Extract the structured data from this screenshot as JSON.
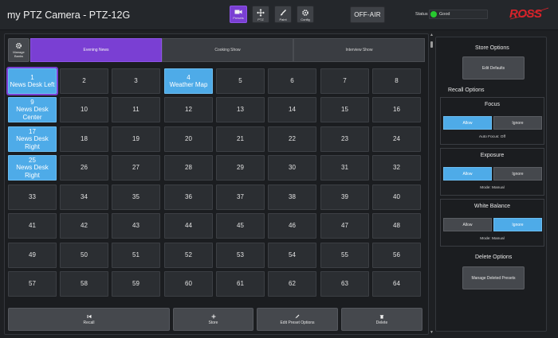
{
  "header": {
    "title": "my PTZ Camera - PTZ-12G",
    "nav": [
      {
        "label": "Presets",
        "icon": "camera-icon",
        "active": true
      },
      {
        "label": "PTZ",
        "icon": "move-arrows-icon",
        "active": false
      },
      {
        "label": "Paint",
        "icon": "paint-brush-icon",
        "active": false
      },
      {
        "label": "Config",
        "icon": "gear-icon",
        "active": false
      }
    ],
    "offair_label": "OFF-AIR",
    "status_label": "Status",
    "status_value": "Good",
    "status_color": "#27c92f",
    "brand": "ROSS"
  },
  "banks": {
    "manage_label": "Manage Banks",
    "tabs": [
      "Evening News",
      "Cooking Show",
      "Interview Show"
    ],
    "active_tab": "Evening News"
  },
  "presets": [
    {
      "n": "1",
      "name": "News Desk Left",
      "stored": true,
      "selected": true
    },
    {
      "n": "2"
    },
    {
      "n": "3"
    },
    {
      "n": "4",
      "name": "Weather Map",
      "stored": true
    },
    {
      "n": "5"
    },
    {
      "n": "6"
    },
    {
      "n": "7"
    },
    {
      "n": "8"
    },
    {
      "n": "9",
      "name": "News Desk Center",
      "stored": true
    },
    {
      "n": "10"
    },
    {
      "n": "11"
    },
    {
      "n": "12"
    },
    {
      "n": "13"
    },
    {
      "n": "14"
    },
    {
      "n": "15"
    },
    {
      "n": "16"
    },
    {
      "n": "17",
      "name": "News Desk Right",
      "stored": true
    },
    {
      "n": "18"
    },
    {
      "n": "19"
    },
    {
      "n": "20"
    },
    {
      "n": "21"
    },
    {
      "n": "22"
    },
    {
      "n": "23"
    },
    {
      "n": "24"
    },
    {
      "n": "25",
      "name": "News Desk Right",
      "stored": true
    },
    {
      "n": "26"
    },
    {
      "n": "27"
    },
    {
      "n": "28"
    },
    {
      "n": "29"
    },
    {
      "n": "30"
    },
    {
      "n": "31"
    },
    {
      "n": "32"
    },
    {
      "n": "33"
    },
    {
      "n": "34"
    },
    {
      "n": "35"
    },
    {
      "n": "36"
    },
    {
      "n": "37"
    },
    {
      "n": "38"
    },
    {
      "n": "39"
    },
    {
      "n": "40"
    },
    {
      "n": "41"
    },
    {
      "n": "42"
    },
    {
      "n": "43"
    },
    {
      "n": "44"
    },
    {
      "n": "45"
    },
    {
      "n": "46"
    },
    {
      "n": "47"
    },
    {
      "n": "48"
    },
    {
      "n": "49"
    },
    {
      "n": "50"
    },
    {
      "n": "51"
    },
    {
      "n": "52"
    },
    {
      "n": "53"
    },
    {
      "n": "54"
    },
    {
      "n": "55"
    },
    {
      "n": "56"
    },
    {
      "n": "57"
    },
    {
      "n": "58"
    },
    {
      "n": "59"
    },
    {
      "n": "60"
    },
    {
      "n": "61"
    },
    {
      "n": "62"
    },
    {
      "n": "63"
    },
    {
      "n": "64"
    }
  ],
  "actions": {
    "recall": "Recall",
    "store": "Store",
    "edit": "Edit Preset Options",
    "delete": "Delete"
  },
  "store_options": {
    "heading": "Store Options",
    "edit_defaults": "Edit Defaults"
  },
  "recall_options": {
    "heading": "Recall Options",
    "focus": {
      "title": "Focus",
      "allow": "Allow",
      "ignore": "Ignore",
      "selected": "Allow",
      "status": "Auto Focus: Off"
    },
    "exposure": {
      "title": "Exposure",
      "allow": "Allow",
      "ignore": "Ignore",
      "selected": "Allow",
      "status": "Mode: Manual"
    },
    "white_balance": {
      "title": "White Balance",
      "allow": "Allow",
      "ignore": "Ignore",
      "selected": "Ignore",
      "status": "Mode: Manual"
    }
  },
  "delete_options": {
    "heading": "Delete Options",
    "manage_deleted": "Manage Deleted Presets"
  },
  "colors": {
    "accent_purple": "#7a3fd3",
    "stored_blue": "#4eabe8",
    "brand_red": "#d8232a"
  }
}
